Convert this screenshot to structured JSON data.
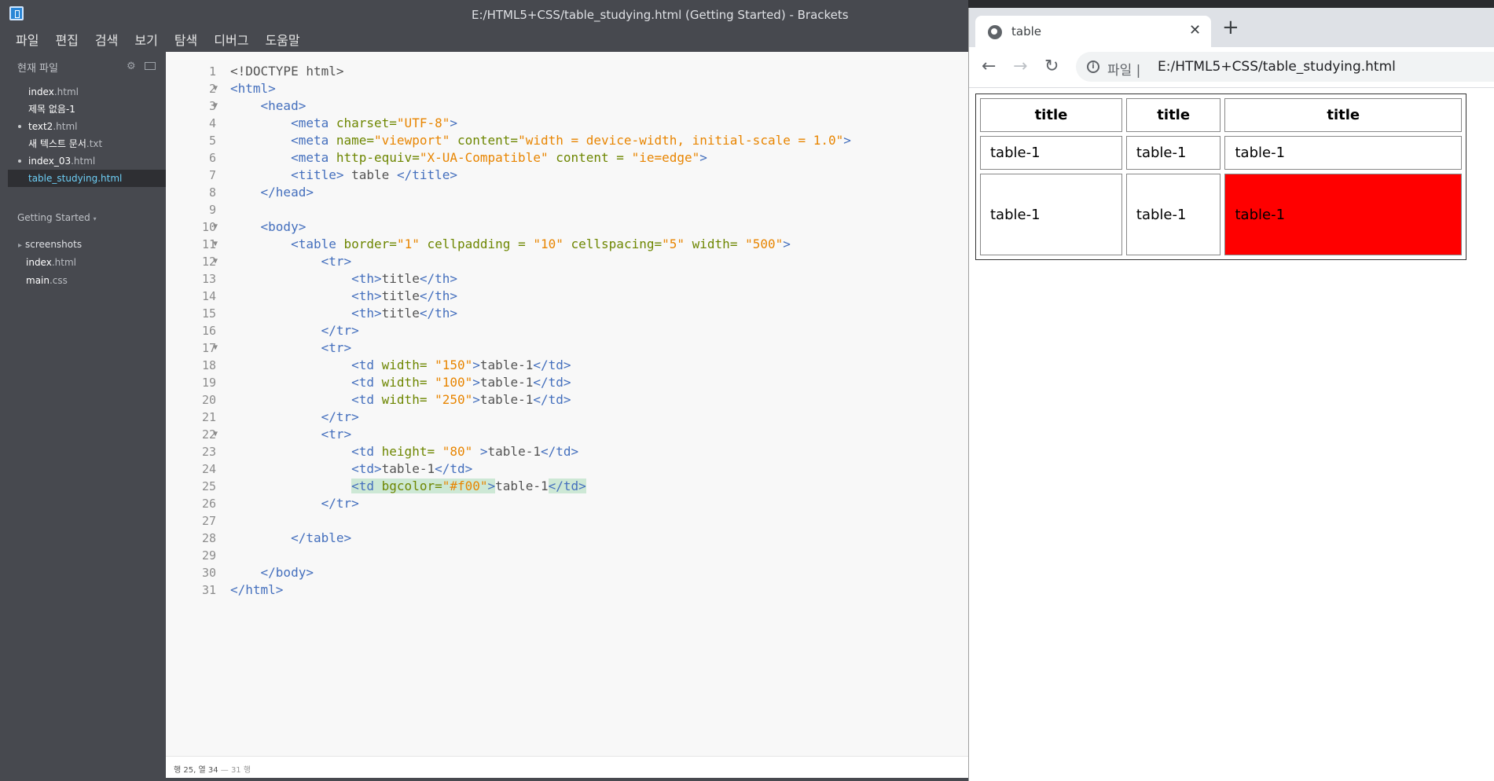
{
  "brackets": {
    "window_title": "E:/HTML5+CSS/table_studying.html (Getting Started) - Brackets",
    "menu": [
      "파일",
      "편집",
      "검색",
      "보기",
      "탐색",
      "디버그",
      "도움말"
    ],
    "sidebar": {
      "header": "현재 파일",
      "working_files": [
        {
          "name": "index",
          "ext": ".html",
          "dirty": false,
          "selected": false
        },
        {
          "name": "제목 없음-1",
          "ext": "",
          "dirty": false,
          "selected": false
        },
        {
          "name": "text2",
          "ext": ".html",
          "dirty": true,
          "selected": false
        },
        {
          "name": "새 텍스트 문서",
          "ext": ".txt",
          "dirty": false,
          "selected": false
        },
        {
          "name": "index_03",
          "ext": ".html",
          "dirty": true,
          "selected": false
        },
        {
          "name": "table_studying",
          "ext": ".html",
          "dirty": false,
          "selected": true
        }
      ],
      "project_title": "Getting Started",
      "project_tree": [
        {
          "name": "screenshots",
          "ext": "",
          "folder": true
        },
        {
          "name": "index",
          "ext": ".html",
          "folder": false
        },
        {
          "name": "main",
          "ext": ".css",
          "folder": false
        }
      ]
    },
    "code_lines": [
      {
        "n": "1",
        "fold": false,
        "parts": [
          [
            "txt",
            "<!DOCTYPE html>"
          ]
        ]
      },
      {
        "n": "2",
        "fold": true,
        "parts": [
          [
            "tag",
            "<html>"
          ]
        ]
      },
      {
        "n": "3",
        "fold": true,
        "parts": [
          [
            "txt",
            "    "
          ],
          [
            "tag",
            "<head>"
          ]
        ]
      },
      {
        "n": "4",
        "fold": false,
        "parts": [
          [
            "txt",
            "        "
          ],
          [
            "tag",
            "<meta "
          ],
          [
            "att",
            "charset="
          ],
          [
            "str",
            "\"UTF-8\""
          ],
          [
            "tag",
            ">"
          ]
        ]
      },
      {
        "n": "5",
        "fold": false,
        "parts": [
          [
            "txt",
            "        "
          ],
          [
            "tag",
            "<meta "
          ],
          [
            "att",
            "name="
          ],
          [
            "str",
            "\"viewport\""
          ],
          [
            "att",
            " content="
          ],
          [
            "str",
            "\"width = device-width, initial-scale = 1.0\""
          ],
          [
            "tag",
            ">"
          ]
        ]
      },
      {
        "n": "6",
        "fold": false,
        "parts": [
          [
            "txt",
            "        "
          ],
          [
            "tag",
            "<meta "
          ],
          [
            "att",
            "http-equiv="
          ],
          [
            "str",
            "\"X-UA-Compatible\""
          ],
          [
            "att",
            " content = "
          ],
          [
            "str",
            "\"ie=edge\""
          ],
          [
            "tag",
            ">"
          ]
        ]
      },
      {
        "n": "7",
        "fold": false,
        "parts": [
          [
            "txt",
            "        "
          ],
          [
            "tag",
            "<title>"
          ],
          [
            "txt",
            " table "
          ],
          [
            "tag",
            "</title>"
          ]
        ]
      },
      {
        "n": "8",
        "fold": false,
        "parts": [
          [
            "txt",
            "    "
          ],
          [
            "tag",
            "</head>"
          ]
        ]
      },
      {
        "n": "9",
        "fold": false,
        "parts": [
          [
            "txt",
            ""
          ]
        ]
      },
      {
        "n": "10",
        "fold": true,
        "parts": [
          [
            "txt",
            "    "
          ],
          [
            "tag",
            "<body>"
          ]
        ]
      },
      {
        "n": "11",
        "fold": true,
        "parts": [
          [
            "txt",
            "        "
          ],
          [
            "tag",
            "<table "
          ],
          [
            "att",
            "border="
          ],
          [
            "str",
            "\"1\""
          ],
          [
            "att",
            " cellpadding = "
          ],
          [
            "str",
            "\"10\""
          ],
          [
            "att",
            " cellspacing="
          ],
          [
            "str",
            "\"5\""
          ],
          [
            "att",
            " width= "
          ],
          [
            "str",
            "\"500\""
          ],
          [
            "tag",
            ">"
          ]
        ]
      },
      {
        "n": "12",
        "fold": true,
        "parts": [
          [
            "txt",
            "            "
          ],
          [
            "tag",
            "<tr>"
          ]
        ]
      },
      {
        "n": "13",
        "fold": false,
        "parts": [
          [
            "txt",
            "                "
          ],
          [
            "tag",
            "<th>"
          ],
          [
            "txt",
            "title"
          ],
          [
            "tag",
            "</th>"
          ]
        ]
      },
      {
        "n": "14",
        "fold": false,
        "parts": [
          [
            "txt",
            "                "
          ],
          [
            "tag",
            "<th>"
          ],
          [
            "txt",
            "title"
          ],
          [
            "tag",
            "</th>"
          ]
        ]
      },
      {
        "n": "15",
        "fold": false,
        "parts": [
          [
            "txt",
            "                "
          ],
          [
            "tag",
            "<th>"
          ],
          [
            "txt",
            "title"
          ],
          [
            "tag",
            "</th>"
          ]
        ]
      },
      {
        "n": "16",
        "fold": false,
        "parts": [
          [
            "txt",
            "            "
          ],
          [
            "tag",
            "</tr>"
          ]
        ]
      },
      {
        "n": "17",
        "fold": true,
        "parts": [
          [
            "txt",
            "            "
          ],
          [
            "tag",
            "<tr>"
          ]
        ]
      },
      {
        "n": "18",
        "fold": false,
        "parts": [
          [
            "txt",
            "                "
          ],
          [
            "tag",
            "<td "
          ],
          [
            "att",
            "width= "
          ],
          [
            "str",
            "\"150\""
          ],
          [
            "tag",
            ">"
          ],
          [
            "txt",
            "table-1"
          ],
          [
            "tag",
            "</td>"
          ]
        ]
      },
      {
        "n": "19",
        "fold": false,
        "parts": [
          [
            "txt",
            "                "
          ],
          [
            "tag",
            "<td "
          ],
          [
            "att",
            "width= "
          ],
          [
            "str",
            "\"100\""
          ],
          [
            "tag",
            ">"
          ],
          [
            "txt",
            "table-1"
          ],
          [
            "tag",
            "</td>"
          ]
        ]
      },
      {
        "n": "20",
        "fold": false,
        "parts": [
          [
            "txt",
            "                "
          ],
          [
            "tag",
            "<td "
          ],
          [
            "att",
            "width= "
          ],
          [
            "str",
            "\"250\""
          ],
          [
            "tag",
            ">"
          ],
          [
            "txt",
            "table-1"
          ],
          [
            "tag",
            "</td>"
          ]
        ]
      },
      {
        "n": "21",
        "fold": false,
        "parts": [
          [
            "txt",
            "            "
          ],
          [
            "tag",
            "</tr>"
          ]
        ]
      },
      {
        "n": "22",
        "fold": true,
        "parts": [
          [
            "txt",
            "            "
          ],
          [
            "tag",
            "<tr>"
          ]
        ]
      },
      {
        "n": "23",
        "fold": false,
        "parts": [
          [
            "txt",
            "                "
          ],
          [
            "tag",
            "<td "
          ],
          [
            "att",
            "height= "
          ],
          [
            "str",
            "\"80\""
          ],
          [
            "txt",
            " "
          ],
          [
            "tag",
            ">"
          ],
          [
            "txt",
            "table-1"
          ],
          [
            "tag",
            "</td>"
          ]
        ]
      },
      {
        "n": "24",
        "fold": false,
        "parts": [
          [
            "txt",
            "                "
          ],
          [
            "tag",
            "<td>"
          ],
          [
            "txt",
            "table-1"
          ],
          [
            "tag",
            "</td>"
          ]
        ]
      },
      {
        "n": "25",
        "fold": false,
        "parts": [
          [
            "txt",
            "                "
          ],
          [
            "tag hl",
            "<td "
          ],
          [
            "att hl",
            "bgcolor="
          ],
          [
            "str hl",
            "\"#f00\""
          ],
          [
            "tag hl",
            ">"
          ],
          [
            "txt",
            "table-1"
          ],
          [
            "tag hl",
            "</td>"
          ]
        ]
      },
      {
        "n": "26",
        "fold": false,
        "parts": [
          [
            "txt",
            "            "
          ],
          [
            "tag",
            "</tr>"
          ]
        ]
      },
      {
        "n": "27",
        "fold": false,
        "parts": [
          [
            "txt",
            ""
          ]
        ]
      },
      {
        "n": "28",
        "fold": false,
        "parts": [
          [
            "txt",
            "        "
          ],
          [
            "tag",
            "</table>"
          ]
        ]
      },
      {
        "n": "29",
        "fold": false,
        "parts": [
          [
            "txt",
            ""
          ]
        ]
      },
      {
        "n": "30",
        "fold": false,
        "parts": [
          [
            "txt",
            "    "
          ],
          [
            "tag",
            "</body>"
          ]
        ]
      },
      {
        "n": "31",
        "fold": false,
        "parts": [
          [
            "tag",
            "</html>"
          ]
        ]
      }
    ],
    "status": {
      "position": "행 25, 열 34",
      "separator": " — ",
      "lines": "31 행"
    }
  },
  "chrome": {
    "tab_title": "table",
    "url_scheme": "파일  |",
    "url": "E:/HTML5+CSS/table_studying.html",
    "table": {
      "headers": [
        "title",
        "title",
        "title"
      ],
      "rows": [
        [
          "table-1",
          "table-1",
          "table-1"
        ],
        [
          "table-1",
          "table-1",
          "table-1"
        ]
      ],
      "highlight_color": "#ff0000"
    }
  },
  "colors": {
    "tag": "#446fbd",
    "attribute": "#6d8600",
    "string": "#e88501",
    "sidebar_bg": "#47494f",
    "selected_file": "#6ecff6"
  }
}
